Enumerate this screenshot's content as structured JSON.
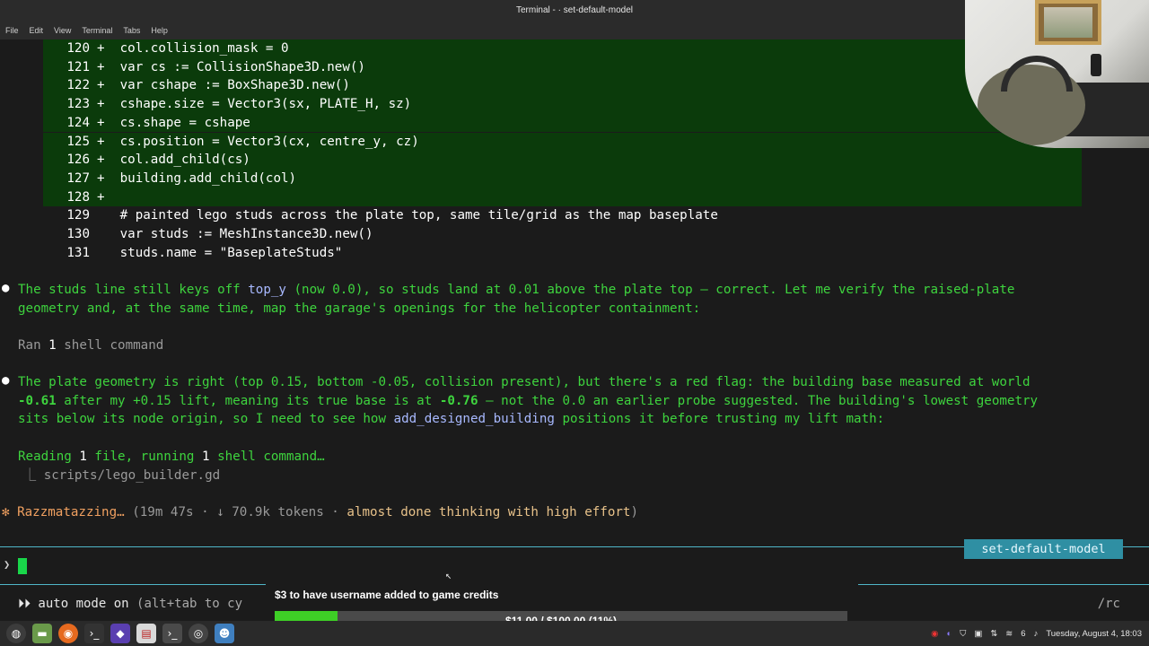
{
  "window": {
    "title": "Terminal - · set-default-model"
  },
  "menu": [
    "File",
    "Edit",
    "View",
    "Terminal",
    "Tabs",
    "Help"
  ],
  "diff_lines": [
    {
      "num": "120",
      "sign": "+",
      "code": "col.collision_mask = 0"
    },
    {
      "num": "121",
      "sign": "+",
      "code": "var cs := CollisionShape3D.new()"
    },
    {
      "num": "122",
      "sign": "+",
      "code": "var cshape := BoxShape3D.new()"
    },
    {
      "num": "123",
      "sign": "+",
      "code": "cshape.size = Vector3(sx, PLATE_H, sz)"
    },
    {
      "num": "124",
      "sign": "+",
      "code": "cs.shape = cshape"
    },
    {
      "num": "125",
      "sign": "+",
      "code": "cs.position = Vector3(cx, centre_y, cz)"
    },
    {
      "num": "126",
      "sign": "+",
      "code": "col.add_child(cs)"
    },
    {
      "num": "127",
      "sign": "+",
      "code": "building.add_child(col)"
    },
    {
      "num": "128",
      "sign": "+",
      "code": ""
    }
  ],
  "context_lines": [
    {
      "num": "129",
      "code": "# painted lego studs across the plate top, same tile/grid as the map baseplate"
    },
    {
      "num": "130",
      "code": "var studs := MeshInstance3D.new()"
    },
    {
      "num": "131",
      "code": "studs.name = \"BaseplateStuds\""
    }
  ],
  "messages": {
    "m1a": "The studs line still keys off ",
    "m1b": "top_y",
    "m1c": " (now 0.0), so studs land at 0.01 above the plate top — correct. Let me verify the raised-plate",
    "m1d": "geometry and, at the same time, map the garage's openings for the helicopter containment:",
    "ran_a": "Ran ",
    "ran_b": "1",
    "ran_c": " shell command",
    "m2a": "The plate geometry is right (top 0.15, bottom -0.05, collision present), but there's a red flag: the building base measured at world",
    "m2b": "-0.61",
    "m2c": " after my +0.15 lift, meaning its true base is at ",
    "m2d": "-0.76",
    "m2e": " — not the 0.0 an earlier probe suggested. The building's lowest geometry",
    "m2f": "sits below its node origin, so I need to see how ",
    "m2g": "add_designed_building",
    "m2h": " positions it before trusting my lift math:",
    "read_a": "Reading ",
    "read_b": "1",
    "read_c": " file, running ",
    "read_d": "1",
    "read_e": " shell command…",
    "file": "⎿ scripts/lego_builder.gd",
    "status_star": "✻",
    "status_name": "Razzmatazzing…",
    "status_a": " (19m 47s · ↓ 70.9k tokens · ",
    "status_b": "almost done thinking with high effort",
    "status_c": ")"
  },
  "mode_badge": "set-default-model",
  "prompt_symbol": "❯",
  "auto_mode": {
    "arrows": "⏵⏵",
    "label": " auto mode on ",
    "hint": "(alt+tab to cy"
  },
  "rc_label": "/rc",
  "donation": {
    "title": "$3 to have username added to game credits",
    "progress_text": "$11.00 / $100.00 (11%)",
    "progress": 0.11
  },
  "taskbar": {
    "icons": [
      "menu-icon",
      "files-icon",
      "firefox-icon",
      "terminal-icon",
      "obsidian-icon",
      "editor-icon",
      "terminal-active-icon",
      "obs-icon",
      "godot-icon"
    ],
    "tray_volume": "6",
    "clock": "Tuesday, August  4, 18:03"
  },
  "colors": {
    "accent": "#4fb6c8",
    "green_text": "#3ed43e",
    "diff_bg": "#0b3b0b",
    "progress": "#3ecf26"
  }
}
